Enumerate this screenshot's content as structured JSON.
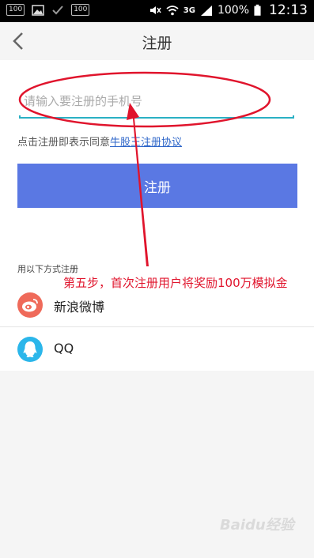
{
  "status_bar": {
    "notif_badge_1": "100",
    "notif_badge_2": "100",
    "network": "3G",
    "battery": "100%",
    "time": "12:13"
  },
  "nav": {
    "title": "注册"
  },
  "form": {
    "phone_placeholder": "请输入要注册的手机号",
    "phone_value": "",
    "agreement_prefix": "点击注册即表示同意",
    "agreement_link": "牛股王注册协议",
    "register_label": "注册",
    "alt_login_label": "用以下方式注册"
  },
  "alt_logins": [
    {
      "label": "新浪微博",
      "icon": "weibo-icon"
    },
    {
      "label": "QQ",
      "icon": "qq-icon"
    }
  ],
  "annotation": {
    "text": "第五步，首次注册用户将奖励100万模拟金"
  },
  "colors": {
    "primary_button": "#5a78e3",
    "input_underline": "#2ab0c4",
    "link": "#2e66c9",
    "annotation": "#e0142c",
    "weibo": "#ef6a5a",
    "qq": "#2bb6ea"
  },
  "watermark": {
    "text": "Baidu经验"
  }
}
